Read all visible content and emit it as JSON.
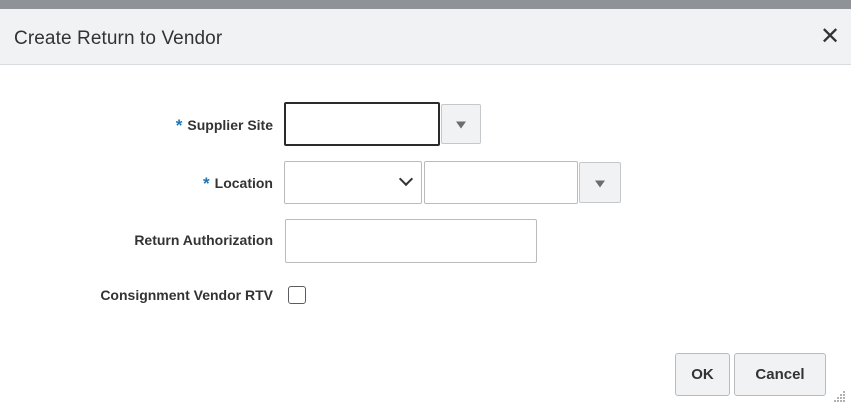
{
  "dialog": {
    "title": "Create Return to Vendor",
    "close_glyph": "✕"
  },
  "form": {
    "required_marker": "*",
    "supplier_site": {
      "label": "Supplier Site",
      "value": ""
    },
    "location": {
      "label": "Location",
      "type_value": "",
      "value": ""
    },
    "return_authorization": {
      "label": "Return Authorization",
      "value": ""
    },
    "consignment_vendor_rtv": {
      "label": "Consignment Vendor RTV",
      "checked": false
    }
  },
  "buttons": {
    "ok": "OK",
    "cancel": "Cancel"
  },
  "icons": {
    "close": "close-icon",
    "dropdown": "triangle-down-icon",
    "chevron": "chevron-down-icon"
  },
  "colors": {
    "required_marker": "#1f74b5",
    "header_bg": "#f1f2f3",
    "top_strip": "#8f9296"
  }
}
